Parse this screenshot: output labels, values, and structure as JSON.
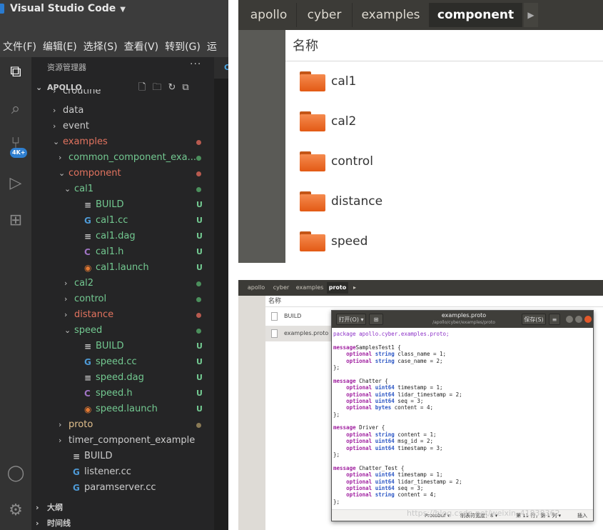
{
  "vscode": {
    "title": "Visual Studio Code",
    "menu": [
      "文件(F)",
      "编辑(E)",
      "选择(S)",
      "查看(V)",
      "转到(G)",
      "运"
    ],
    "explorer_title": "资源管理器",
    "more": "···",
    "project": "APOLLO",
    "badge": "4K+",
    "partial_row": "croutine",
    "editor_tab": "C",
    "tree": [
      {
        "label": "data",
        "depth": 1,
        "kind": "folder",
        "open": false,
        "color": "#cccccc",
        "status": "",
        "dot": ""
      },
      {
        "label": "event",
        "depth": 1,
        "kind": "folder",
        "open": false,
        "color": "#cccccc",
        "status": "",
        "dot": ""
      },
      {
        "label": "examples",
        "depth": 1,
        "kind": "folder",
        "open": true,
        "color": "#e2735f",
        "status": "",
        "dot": "#b85a4f"
      },
      {
        "label": "common_component_exa...",
        "depth": 2,
        "kind": "folder",
        "open": false,
        "color": "#73c991",
        "status": "",
        "dot": "#4b8f5c"
      },
      {
        "label": "component",
        "depth": 2,
        "kind": "folder",
        "open": true,
        "color": "#e2735f",
        "status": "",
        "dot": "#b85a4f"
      },
      {
        "label": "cal1",
        "depth": 3,
        "kind": "folder",
        "open": true,
        "color": "#73c991",
        "status": "",
        "dot": "#4b8f5c"
      },
      {
        "label": "BUILD",
        "depth": 4,
        "kind": "lines",
        "open": false,
        "color": "#73c991",
        "status": "U",
        "dot": ""
      },
      {
        "label": "cal1.cc",
        "depth": 4,
        "kind": "cpp",
        "open": false,
        "color": "#73c991",
        "status": "U",
        "dot": ""
      },
      {
        "label": "cal1.dag",
        "depth": 4,
        "kind": "lines",
        "open": false,
        "color": "#73c991",
        "status": "U",
        "dot": ""
      },
      {
        "label": "cal1.h",
        "depth": 4,
        "kind": "h",
        "open": false,
        "color": "#73c991",
        "status": "U",
        "dot": ""
      },
      {
        "label": "cal1.launch",
        "depth": 4,
        "kind": "rss",
        "open": false,
        "color": "#73c991",
        "status": "U",
        "dot": ""
      },
      {
        "label": "cal2",
        "depth": 3,
        "kind": "folder",
        "open": false,
        "color": "#73c991",
        "status": "",
        "dot": "#4b8f5c"
      },
      {
        "label": "control",
        "depth": 3,
        "kind": "folder",
        "open": false,
        "color": "#73c991",
        "status": "",
        "dot": "#4b8f5c"
      },
      {
        "label": "distance",
        "depth": 3,
        "kind": "folder",
        "open": false,
        "color": "#e2735f",
        "status": "",
        "dot": "#b85a4f"
      },
      {
        "label": "speed",
        "depth": 3,
        "kind": "folder",
        "open": true,
        "color": "#73c991",
        "status": "",
        "dot": "#4b8f5c"
      },
      {
        "label": "BUILD",
        "depth": 4,
        "kind": "lines",
        "open": false,
        "color": "#73c991",
        "status": "U",
        "dot": ""
      },
      {
        "label": "speed.cc",
        "depth": 4,
        "kind": "cpp",
        "open": false,
        "color": "#73c991",
        "status": "U",
        "dot": ""
      },
      {
        "label": "speed.dag",
        "depth": 4,
        "kind": "lines",
        "open": false,
        "color": "#73c991",
        "status": "U",
        "dot": ""
      },
      {
        "label": "speed.h",
        "depth": 4,
        "kind": "h",
        "open": false,
        "color": "#73c991",
        "status": "U",
        "dot": ""
      },
      {
        "label": "speed.launch",
        "depth": 4,
        "kind": "rss",
        "open": false,
        "color": "#73c991",
        "status": "U",
        "dot": ""
      },
      {
        "label": "proto",
        "depth": 2,
        "kind": "folder",
        "open": false,
        "color": "#e2c08d",
        "status": "",
        "dot": "#8a7a55"
      },
      {
        "label": "timer_component_example",
        "depth": 2,
        "kind": "folder",
        "open": false,
        "color": "#cccccc",
        "status": "",
        "dot": ""
      },
      {
        "label": "BUILD",
        "depth": 2,
        "kind": "lines",
        "open": false,
        "color": "#cccccc",
        "status": "",
        "dot": ""
      },
      {
        "label": "listener.cc",
        "depth": 2,
        "kind": "cpp",
        "open": false,
        "color": "#cccccc",
        "status": "",
        "dot": ""
      },
      {
        "label": "paramserver.cc",
        "depth": 2,
        "kind": "cpp",
        "open": false,
        "color": "#cccccc",
        "status": "",
        "dot": ""
      }
    ],
    "outline": "大纲",
    "timeline": "时间线"
  },
  "files": {
    "breadcrumbs": [
      "apollo",
      "cyber",
      "examples",
      "component"
    ],
    "active_crumb": "component",
    "column_header": "名称",
    "folders": [
      "cal1",
      "cal2",
      "control",
      "distance",
      "speed"
    ]
  },
  "proto_window": {
    "breadcrumbs": [
      "apollo",
      "cyber",
      "examples",
      "proto"
    ],
    "column_header": "名称",
    "files": [
      "BUILD",
      "examples.proto"
    ],
    "editor": {
      "open_label": "打开(O) ▾",
      "save_label": "保存(S)",
      "menu_label": "≡",
      "filename": "examples.proto",
      "path": "/apollo/cyber/examples/proto",
      "status_lang": "Protobuf ▾",
      "status_tab": "制表符宽度：8 ▾",
      "status_pos": "第 11 行，第 1 列 ▾",
      "status_ins": "插入"
    },
    "code": [
      [
        [
          "pk",
          "package apollo.cyber.examples.proto;"
        ]
      ],
      [],
      [
        [
          "kw",
          "message"
        ],
        [
          "",
          "SamplesTest1 {"
        ]
      ],
      [
        [
          "",
          "    "
        ],
        [
          "kw",
          "optional"
        ],
        [
          "",
          ""
        ],
        [
          "ty",
          " string"
        ],
        [
          "",
          " class_name = 1;"
        ]
      ],
      [
        [
          "",
          "    "
        ],
        [
          "kw",
          "optional"
        ],
        [
          "ty",
          " string"
        ],
        [
          "",
          " case_name = 2;"
        ]
      ],
      [
        [
          "",
          "};"
        ]
      ],
      [],
      [
        [
          "kw",
          "message"
        ],
        [
          "",
          " Chatter {"
        ]
      ],
      [
        [
          "",
          "    "
        ],
        [
          "kw",
          "optional"
        ],
        [
          "ty",
          " uint64"
        ],
        [
          "",
          " timestamp = 1;"
        ]
      ],
      [
        [
          "",
          "    "
        ],
        [
          "kw",
          "optional"
        ],
        [
          "ty",
          " uint64"
        ],
        [
          "",
          " lidar_timestamp = 2;"
        ]
      ],
      [
        [
          "",
          "    "
        ],
        [
          "kw",
          "optional"
        ],
        [
          "ty",
          " uint64"
        ],
        [
          "",
          " seq = 3;"
        ]
      ],
      [
        [
          "",
          "    "
        ],
        [
          "kw",
          "optional"
        ],
        [
          "ty",
          " bytes"
        ],
        [
          "",
          " content = 4;"
        ]
      ],
      [
        [
          "",
          "};"
        ]
      ],
      [],
      [
        [
          "kw",
          "message"
        ],
        [
          "",
          " Driver {"
        ]
      ],
      [
        [
          "",
          "    "
        ],
        [
          "kw",
          "optional"
        ],
        [
          "ty",
          " string"
        ],
        [
          "",
          " content = 1;"
        ]
      ],
      [
        [
          "",
          "    "
        ],
        [
          "kw",
          "optional"
        ],
        [
          "ty",
          " uint64"
        ],
        [
          "",
          " msg_id = 2;"
        ]
      ],
      [
        [
          "",
          "    "
        ],
        [
          "kw",
          "optional"
        ],
        [
          "ty",
          " uint64"
        ],
        [
          "",
          " timestamp = 3;"
        ]
      ],
      [
        [
          "",
          "};"
        ]
      ],
      [],
      [
        [
          "kw",
          "message"
        ],
        [
          "",
          " Chatter_Test {"
        ]
      ],
      [
        [
          "",
          "    "
        ],
        [
          "kw",
          "optional"
        ],
        [
          "ty",
          " uint64"
        ],
        [
          "",
          " timestamp = 1;"
        ]
      ],
      [
        [
          "",
          "    "
        ],
        [
          "kw",
          "optional"
        ],
        [
          "ty",
          " uint64"
        ],
        [
          "",
          " lidar_timestamp = 2;"
        ]
      ],
      [
        [
          "",
          "    "
        ],
        [
          "kw",
          "optional"
        ],
        [
          "ty",
          " uint64"
        ],
        [
          "",
          " seq = 3;"
        ]
      ],
      [
        [
          "",
          "    "
        ],
        [
          "kw",
          "optional"
        ],
        [
          "ty",
          " string"
        ],
        [
          "",
          " content = 4;"
        ]
      ],
      [
        [
          "",
          "};"
        ]
      ]
    ]
  },
  "watermark": "https://blog.csdn.net/weixin_41838362"
}
